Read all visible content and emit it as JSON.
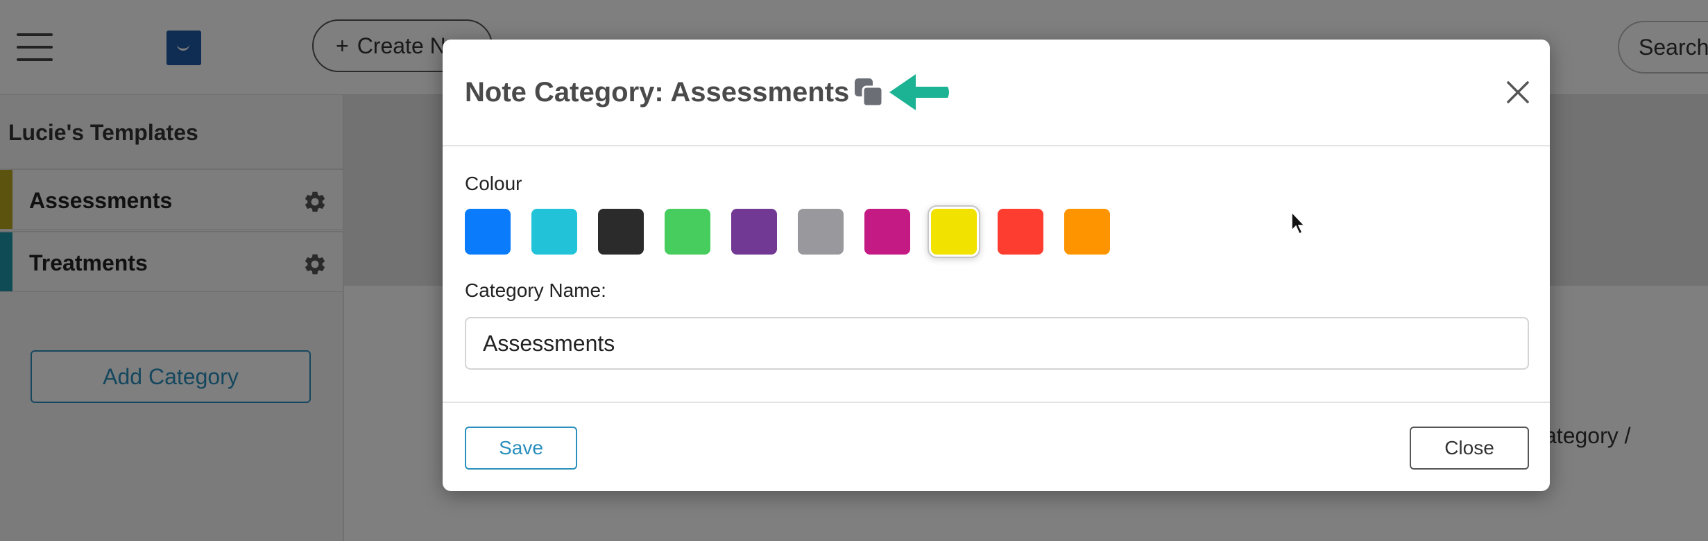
{
  "topbar": {
    "menu_icon": "hamburger-icon",
    "logo_icon": "app-logo-icon",
    "create_button_label": "Create N",
    "create_icon": "plus-icon",
    "search_placeholder": "Search"
  },
  "sidebar": {
    "title": "Lucie's Templates",
    "items": [
      {
        "label": "Assessments",
        "color": "#b8a91c",
        "icon": "gear-icon"
      },
      {
        "label": "Treatments",
        "color": "#1e97a8",
        "icon": "gear-icon"
      }
    ],
    "add_category_label": "Add Category"
  },
  "main": {
    "partial_text": "ategory /"
  },
  "modal": {
    "title": "Note Category: Assessments",
    "copy_icon": "copy-icon",
    "arrow_icon": "arrow-left-icon",
    "close_icon": "close-icon",
    "colour_label": "Colour",
    "colours": [
      {
        "name": "blue",
        "hex": "#0a7cfb"
      },
      {
        "name": "cyan",
        "hex": "#22c2d9"
      },
      {
        "name": "black",
        "hex": "#2b2b2b"
      },
      {
        "name": "green",
        "hex": "#46cd5d"
      },
      {
        "name": "purple",
        "hex": "#713894"
      },
      {
        "name": "grey",
        "hex": "#98989d"
      },
      {
        "name": "magenta",
        "hex": "#c41a84"
      },
      {
        "name": "yellow",
        "hex": "#f1e200",
        "selected": true
      },
      {
        "name": "red",
        "hex": "#fd3d30"
      },
      {
        "name": "orange",
        "hex": "#fe9500"
      }
    ],
    "category_name_label": "Category Name:",
    "category_name_value": "Assessments",
    "save_label": "Save",
    "close_label": "Close"
  },
  "accent_arrow_color": "#1bb394"
}
